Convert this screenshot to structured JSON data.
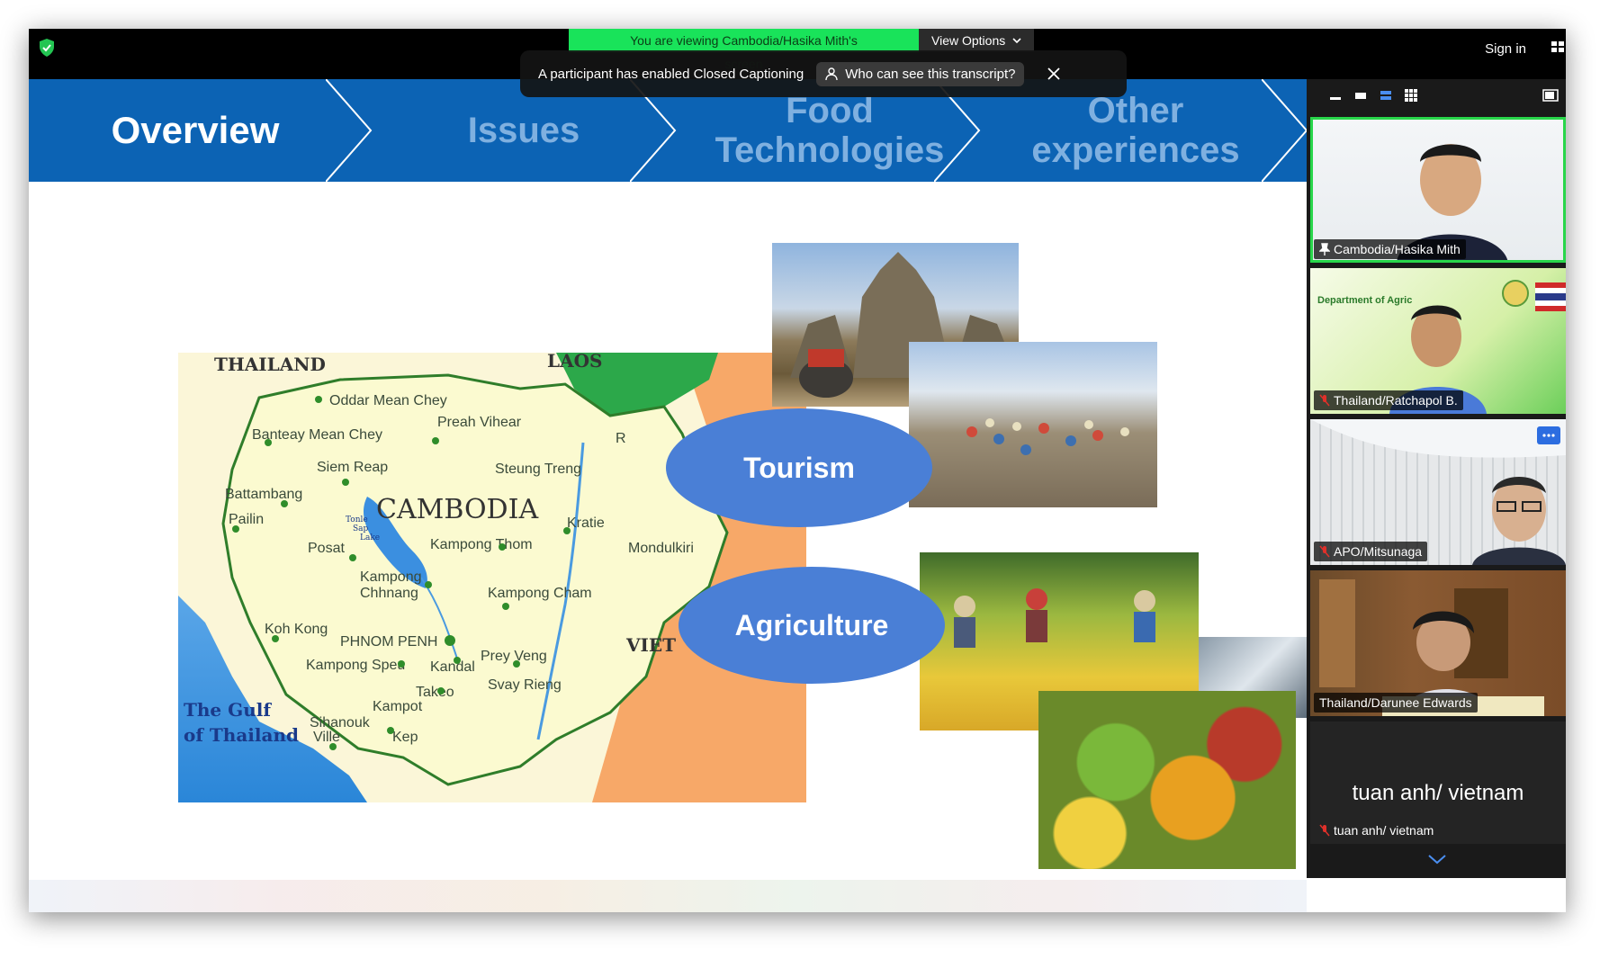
{
  "topbar": {
    "share_banner": "You are viewing Cambodia/Hasika Mith's screen",
    "view_options": "View Options",
    "sign_in": "Sign in"
  },
  "cc_toast": {
    "message": "A participant has enabled Closed Captioning",
    "who_can_see": "Who can see this transcript?"
  },
  "slide": {
    "tabs": [
      {
        "line1": "Overview",
        "line2": "",
        "active": true
      },
      {
        "line1": "Issues",
        "line2": "",
        "active": false
      },
      {
        "line1": "Food",
        "line2": "Technologies",
        "active": false
      },
      {
        "line1": "Other",
        "line2": "experiences",
        "active": false
      }
    ],
    "tourism": "Tourism",
    "agriculture": "Agriculture",
    "map": {
      "country": "CAMBODIA",
      "neighbors": {
        "thailand": "THAILAND",
        "laos": "LAOS",
        "vietnam": "VIET",
        "gulf_1": "The Gulf",
        "gulf_2": "of Thailand",
        "lake_1": "Tonle",
        "lake_2": "Sap",
        "lake_3": "Lake",
        "r_cut": "R"
      },
      "places": [
        "Oddar Mean Chey",
        "Preah Vihear",
        "Banteay Mean Chey",
        "Siem Reap",
        "Steung Treng",
        "Battambang",
        "Pailin",
        "Kratie",
        "Posat",
        "Kampong Thom",
        "Mondulkiri",
        "Kampong",
        "Chhnang",
        "Kampong Cham",
        "Koh Kong",
        "PHNOM PENH",
        "Prey Veng",
        "Kampong Speu",
        "Kandal",
        "Svay Rieng",
        "Takeo",
        "Kampot",
        "Sihanouk",
        "Ville",
        "Kep"
      ]
    }
  },
  "participants": [
    {
      "name": "Cambodia/Hasika Mith",
      "status": "pinned",
      "speaking": true
    },
    {
      "name": "Thailand/Ratchapol B.",
      "status": "muted",
      "speaking": false,
      "banner": "Department of Agric"
    },
    {
      "name": "APO/Mitsunaga",
      "status": "muted",
      "speaking": false
    },
    {
      "name": "Thailand/Darunee Edwards",
      "status": "none",
      "speaking": false
    },
    {
      "name": "tuan anh/ vietnam",
      "status": "muted",
      "speaking": false,
      "display_text": "tuan anh/ vietnam"
    }
  ],
  "colors": {
    "nav_blue": "#0c63b4",
    "share_green": "#19e35a",
    "speaking_green": "#28d64a",
    "ellipse_blue": "#4a7fd6",
    "map_land": "#fbfad0",
    "map_border": "#2f7d2a",
    "map_water": "#2a86d8",
    "map_vietnam": "#f7a868",
    "map_laos": "#2ca84a",
    "mute_red": "#e0302a"
  },
  "icons": {
    "security": "shield-icon",
    "view_options": "chevron-down-icon",
    "who_can_see": "person-icon",
    "close": "close-icon",
    "layout": "grid-icon",
    "pin": "pin-icon",
    "mute": "muted-mic-icon",
    "more": "more-icon",
    "scroll": "chevron-down-icon"
  }
}
